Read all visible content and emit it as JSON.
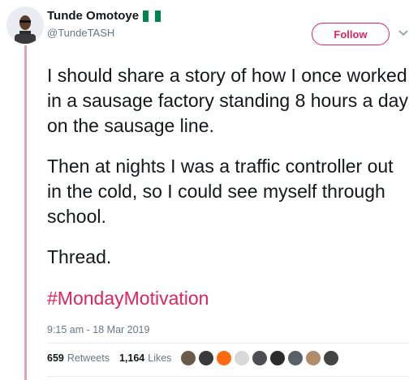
{
  "tweet": {
    "author_name": "Tunde Omotoye",
    "author_handle": "@TundeTASH",
    "flag_icon": "nigeria-flag",
    "follow_label": "Follow",
    "paragraphs": [
      "I should share a story of how I once worked in a sausage factory standing 8 hours a day on the sausage line.",
      "Then at nights I was a traffic controller out in the cold, so I could see myself through school.",
      "Thread."
    ],
    "hashtag": "#MondayMotivation",
    "timestamp": "9:15 am - 18 Mar 2019",
    "stats": {
      "retweets_count": "659",
      "retweets_label": "Retweets",
      "likes_count": "1,164",
      "likes_label": "Likes"
    },
    "colors": {
      "accent": "#e0245e",
      "thread_line": "#e4a3b4",
      "muted": "#657786"
    },
    "liker_avatars": [
      "#6b5a48",
      "#3a3a3a",
      "#ff6a13",
      "#d8d8d8",
      "#4b4f55",
      "#2b2b2b",
      "#5a6068",
      "#b08c6a",
      "#444444"
    ]
  }
}
